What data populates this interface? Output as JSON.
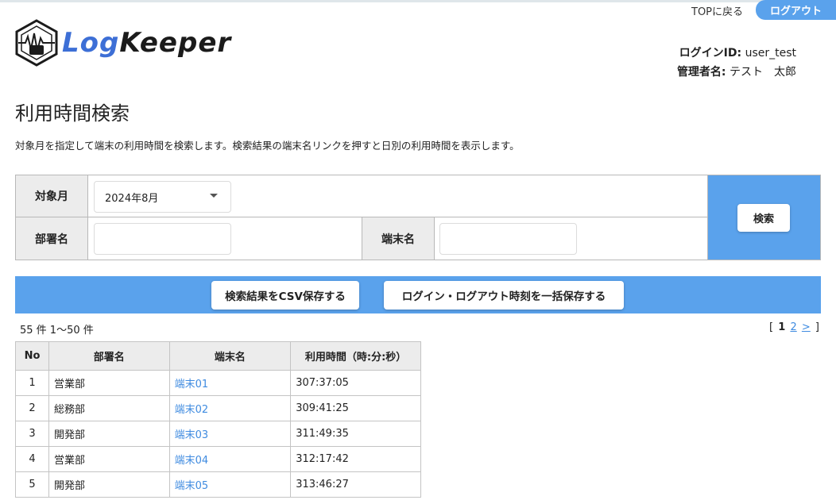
{
  "header": {
    "top_link": "TOPに戻る",
    "logout_label": "ログアウト",
    "logo_text_part1": "Log",
    "logo_text_part2": "Keeper",
    "login_id_label": "ログインID:",
    "login_id_value": "user_test",
    "admin_label": "管理者名:",
    "admin_value": "テスト　太郎"
  },
  "page": {
    "title": "利用時間検索",
    "description": "対象月を指定して端末の利用時間を検索します。検索結果の端末名リンクを押すと日別の利用時間を表示します。"
  },
  "search_form": {
    "month_label": "対象月",
    "month_value": "2024年8月",
    "dept_label": "部署名",
    "dept_value": "",
    "terminal_label": "端末名",
    "terminal_value": "",
    "search_button": "検索"
  },
  "actions": {
    "csv_button": "検索結果をCSV保存する",
    "bulk_button": "ログイン・ログアウト時刻を一括保存する"
  },
  "results": {
    "count_text": "55 件 1〜50 件",
    "pager": {
      "open": "[",
      "current": "1",
      "page2": "2",
      "next": ">",
      "close": "]"
    },
    "columns": [
      "No",
      "部署名",
      "端末名",
      "利用時間（時:分:秒）"
    ],
    "rows": [
      {
        "no": "1",
        "dept": "営業部",
        "terminal": "端末01",
        "time": "307:37:05"
      },
      {
        "no": "2",
        "dept": "総務部",
        "terminal": "端末02",
        "time": "309:41:25"
      },
      {
        "no": "3",
        "dept": "開発部",
        "terminal": "端末03",
        "time": "311:49:35"
      },
      {
        "no": "4",
        "dept": "営業部",
        "terminal": "端末04",
        "time": "312:17:42"
      },
      {
        "no": "5",
        "dept": "開発部",
        "terminal": "端末05",
        "time": "313:46:27"
      }
    ]
  },
  "colors": {
    "accent": "#5aa2ec",
    "link": "#3f8be0",
    "header_cell_bg": "#ececec"
  }
}
